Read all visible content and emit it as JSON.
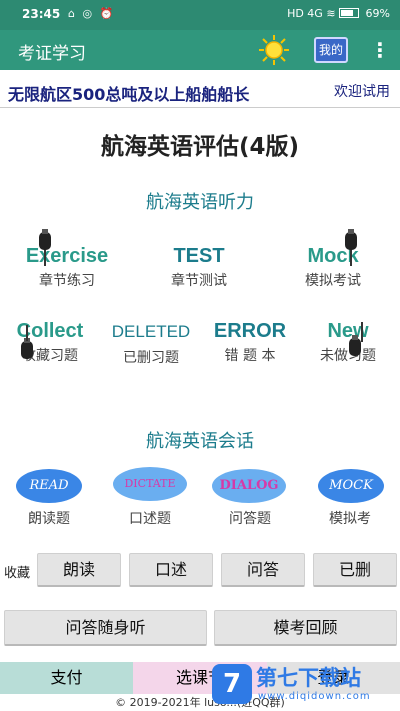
{
  "status_bar": {
    "time": "23:45",
    "signal": "HD 4G",
    "battery": "69%"
  },
  "app_bar": {
    "title": "考证学习",
    "sun_icon": "sun-icon",
    "mine_label": "我的",
    "more_icon": "more-vert-icon"
  },
  "subheader": {
    "exam": "无限航区500总吨及以上船舶船长",
    "welcome": "欢迎试用"
  },
  "main_title": "航海英语评估(4版)",
  "listening": {
    "title": "航海英语听力",
    "row1": [
      {
        "en": "Exercise",
        "cn": "章节练习"
      },
      {
        "en": "TEST",
        "cn": "章节测试"
      },
      {
        "en": "Mock",
        "cn": "模拟考试"
      }
    ],
    "row2": [
      {
        "en": "Collect",
        "cn": "收藏习题"
      },
      {
        "en": "DELETED",
        "cn": "已删习题"
      },
      {
        "en": "ERROR",
        "cn": "错 题 本"
      },
      {
        "en": "New",
        "cn": "未做习题"
      }
    ]
  },
  "conversation": {
    "title": "航海英语会话",
    "items": [
      {
        "bubble": "READ",
        "cn": "朗读题",
        "color": "#3a86e6",
        "text_color": "#ffffff"
      },
      {
        "bubble": "DICTATE",
        "cn": "口述题",
        "color": "#6aaef0",
        "text_color": "#d63aa8"
      },
      {
        "bubble": "DIALOG",
        "cn": "问答题",
        "color": "#6aaef0",
        "text_color": "#d63aa8"
      },
      {
        "bubble": "MOCK",
        "cn": "模拟考",
        "color": "#3a86e6",
        "text_color": "#ffffff"
      }
    ]
  },
  "favorites": {
    "label": "收藏",
    "buttons": [
      "朗读",
      "口述",
      "问答",
      "已删"
    ]
  },
  "actions": {
    "listen": "问答随身听",
    "review": "模考回顾"
  },
  "bottom_bar": {
    "pay": "支付",
    "select": "选课节",
    "reg": "登录"
  },
  "copyright": "© 2019-2021年 luso...(进QQ群)",
  "watermark": {
    "brand": "第七下载站",
    "url": "www.diqidown.com"
  },
  "colors": {
    "primary": "#30977d",
    "status": "#2d8a72",
    "accent": "#1c7c8c"
  }
}
